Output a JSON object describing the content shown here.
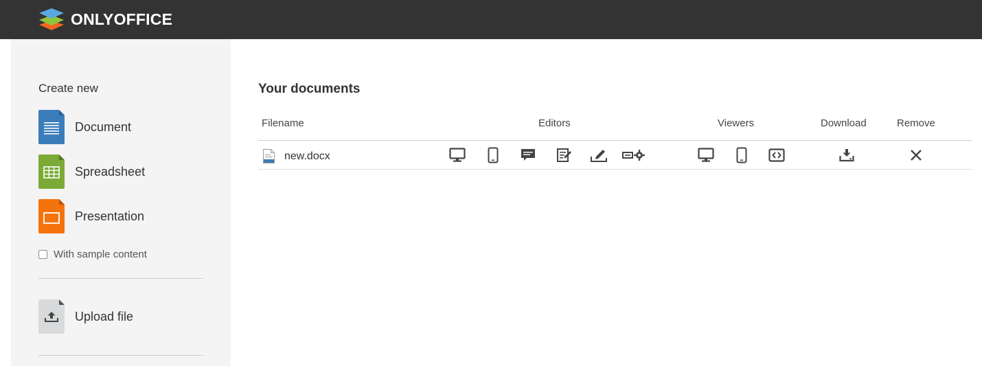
{
  "header": {
    "brand": "ONLYOFFICE",
    "logo_colors": [
      "#5BA8E1",
      "#8DC63F",
      "#F26722"
    ]
  },
  "sidebar": {
    "title": "Create new",
    "create_items": [
      {
        "label": "Document",
        "color": "#3A7DBA"
      },
      {
        "label": "Spreadsheet",
        "color": "#7BAA36"
      },
      {
        "label": "Presentation",
        "color": "#F4730D"
      }
    ],
    "sample_content_label": "With sample content",
    "sample_content_checked": false,
    "upload_label": "Upload file"
  },
  "main": {
    "title": "Your documents",
    "columns": {
      "filename": "Filename",
      "editors": "Editors",
      "viewers": "Viewers",
      "download": "Download",
      "remove": "Remove"
    },
    "files": [
      {
        "name": "new.docx",
        "editor_actions": [
          "desktop-icon",
          "mobile-icon",
          "comment-icon",
          "review-icon",
          "fill-icon",
          "embed-settings-icon"
        ],
        "viewer_actions": [
          "desktop-icon",
          "mobile-icon",
          "embedded-icon"
        ],
        "download_icon": "download-icon",
        "remove_icon": "close-icon"
      }
    ]
  },
  "colors": {
    "header_bg": "#333333",
    "sidebar_bg": "#F4F4F4",
    "icon_color": "#444444"
  }
}
